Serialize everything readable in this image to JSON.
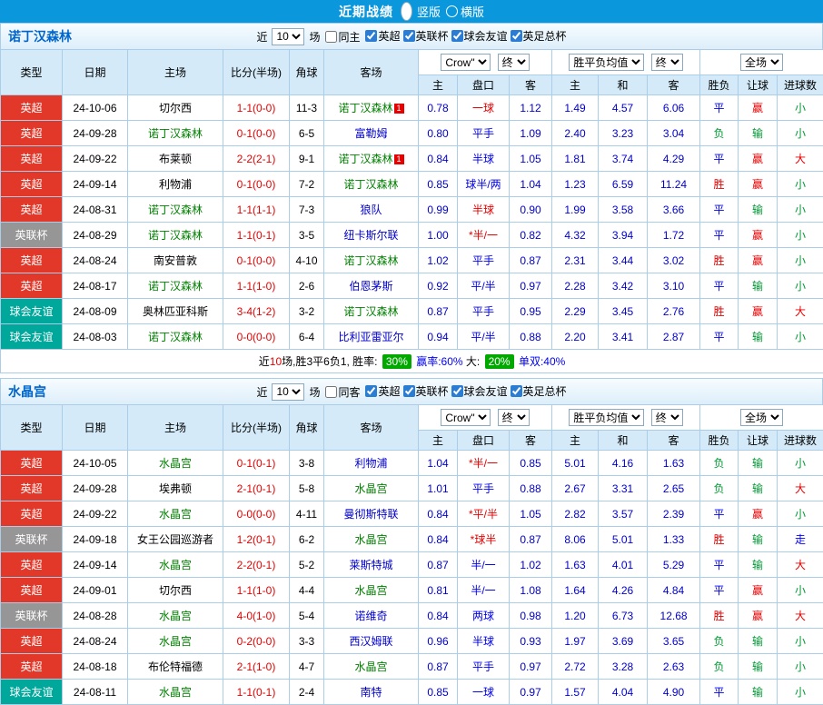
{
  "top_bar": {
    "title": "近期战绩",
    "layout_options": [
      {
        "label": "竖版",
        "selected": true
      },
      {
        "label": "横版",
        "selected": false
      }
    ]
  },
  "table_header": {
    "col_type": "类型",
    "col_date": "日期",
    "col_home": "主场",
    "col_score": "比分(半场)",
    "col_corner": "角球",
    "col_away": "客场",
    "sub_asian_home": "主",
    "sub_handicap": "盘口",
    "sub_asian_away": "客",
    "sub_euro_home": "主",
    "sub_euro_draw": "和",
    "sub_euro_away": "客",
    "sub_result": "胜负",
    "sub_let": "让球",
    "sub_goals": "进球数"
  },
  "colors": {
    "topbar_blue": "#0a97dc",
    "epl_red": "#e1382a",
    "league_cup_gray": "#969696",
    "friendly_teal": "#00a79b",
    "self_team_green": "#008000",
    "away_team_blue": "#0000cc",
    "score_red": "#e60000",
    "odds_blue": "#0000cc",
    "win_red": "#e60000",
    "lose_green": "#009933",
    "draw_blue": "#0000ee",
    "rate_box_green": "#00a800"
  },
  "sections": [
    {
      "team": "诺丁汉森林",
      "filter": {
        "near": "近",
        "count": "10",
        "games": "场",
        "same_label": "同主",
        "same_checked": false,
        "leagues": [
          {
            "label": "英超",
            "checked": true
          },
          {
            "label": "英联杯",
            "checked": true
          },
          {
            "label": "球会友谊",
            "checked": true
          },
          {
            "label": "英足总杯",
            "checked": true
          }
        ]
      },
      "dropdowns": {
        "company": "Crow\"",
        "company_time": "终",
        "euro": "胜平负均值",
        "euro_time": "终",
        "scope": "全场"
      },
      "rows": [
        {
          "type": "英超",
          "tcls": "t-epl",
          "date": "24-10-06",
          "home": "切尔西",
          "hcls": "c-home",
          "score": "1-1(0-0)",
          "corner": "11-3",
          "away": "诺丁汉森林",
          "acls": "c-self",
          "abadge": "1",
          "ah": [
            "0.78",
            "一球",
            "1.12"
          ],
          "lcls": "c-red",
          "eu": [
            "1.49",
            "4.57",
            "6.06"
          ],
          "wdl": "平",
          "wcls": "c-blue",
          "let": "赢",
          "letcls": "c-red",
          "size": "小",
          "scls": "c-green"
        },
        {
          "type": "英超",
          "tcls": "t-epl",
          "date": "24-09-28",
          "home": "诺丁汉森林",
          "hcls": "c-self",
          "score": "0-1(0-0)",
          "corner": "6-5",
          "away": "富勒姆",
          "acls": "c-away",
          "ah": [
            "0.80",
            "平手",
            "1.09"
          ],
          "lcls": "c-blue",
          "eu": [
            "2.40",
            "3.23",
            "3.04"
          ],
          "wdl": "负",
          "wcls": "c-green",
          "let": "输",
          "letcls": "c-green",
          "size": "小",
          "scls": "c-green"
        },
        {
          "type": "英超",
          "tcls": "t-epl",
          "date": "24-09-22",
          "home": "布莱顿",
          "hcls": "c-home",
          "score": "2-2(2-1)",
          "corner": "9-1",
          "away": "诺丁汉森林",
          "acls": "c-self",
          "abadge": "1",
          "ah": [
            "0.84",
            "半球",
            "1.05"
          ],
          "lcls": "c-blue",
          "eu": [
            "1.81",
            "3.74",
            "4.29"
          ],
          "wdl": "平",
          "wcls": "c-blue",
          "let": "赢",
          "letcls": "c-red",
          "size": "大",
          "scls": "c-red"
        },
        {
          "type": "英超",
          "tcls": "t-epl",
          "date": "24-09-14",
          "home": "利物浦",
          "hcls": "c-home",
          "score": "0-1(0-0)",
          "corner": "7-2",
          "away": "诺丁汉森林",
          "acls": "c-self",
          "ah": [
            "0.85",
            "球半/两",
            "1.04"
          ],
          "lcls": "c-blue",
          "eu": [
            "1.23",
            "6.59",
            "11.24"
          ],
          "wdl": "胜",
          "wcls": "c-red",
          "let": "赢",
          "letcls": "c-red",
          "size": "小",
          "scls": "c-green"
        },
        {
          "type": "英超",
          "tcls": "t-epl",
          "date": "24-08-31",
          "home": "诺丁汉森林",
          "hcls": "c-self",
          "score": "1-1(1-1)",
          "corner": "7-3",
          "away": "狼队",
          "acls": "c-away",
          "ah": [
            "0.99",
            "半球",
            "0.90"
          ],
          "lcls": "c-red",
          "eu": [
            "1.99",
            "3.58",
            "3.66"
          ],
          "wdl": "平",
          "wcls": "c-blue",
          "let": "输",
          "letcls": "c-green",
          "size": "小",
          "scls": "c-green"
        },
        {
          "type": "英联杯",
          "tcls": "t-lcup",
          "date": "24-08-29",
          "home": "诺丁汉森林",
          "hcls": "c-self",
          "score": "1-1(0-1)",
          "corner": "3-5",
          "away": "纽卡斯尔联",
          "acls": "c-away",
          "ah": [
            "1.00",
            "*半/一",
            "0.82"
          ],
          "lcls": "c-red",
          "eu": [
            "4.32",
            "3.94",
            "1.72"
          ],
          "wdl": "平",
          "wcls": "c-blue",
          "let": "赢",
          "letcls": "c-red",
          "size": "小",
          "scls": "c-green"
        },
        {
          "type": "英超",
          "tcls": "t-epl",
          "date": "24-08-24",
          "home": "南安普敦",
          "hcls": "c-home",
          "score": "0-1(0-0)",
          "corner": "4-10",
          "away": "诺丁汉森林",
          "acls": "c-self",
          "ah": [
            "1.02",
            "平手",
            "0.87"
          ],
          "lcls": "c-blue",
          "eu": [
            "2.31",
            "3.44",
            "3.02"
          ],
          "wdl": "胜",
          "wcls": "c-red",
          "let": "赢",
          "letcls": "c-red",
          "size": "小",
          "scls": "c-green"
        },
        {
          "type": "英超",
          "tcls": "t-epl",
          "date": "24-08-17",
          "home": "诺丁汉森林",
          "hcls": "c-self",
          "score": "1-1(1-0)",
          "corner": "2-6",
          "away": "伯恩茅斯",
          "acls": "c-away",
          "ah": [
            "0.92",
            "平/半",
            "0.97"
          ],
          "lcls": "c-blue",
          "eu": [
            "2.28",
            "3.42",
            "3.10"
          ],
          "wdl": "平",
          "wcls": "c-blue",
          "let": "输",
          "letcls": "c-green",
          "size": "小",
          "scls": "c-green"
        },
        {
          "type": "球会友谊",
          "tcls": "t-friendly",
          "date": "24-08-09",
          "home": "奥林匹亚科斯",
          "hcls": "c-home",
          "score": "3-4(1-2)",
          "corner": "3-2",
          "away": "诺丁汉森林",
          "acls": "c-self",
          "ah": [
            "0.87",
            "平手",
            "0.95"
          ],
          "lcls": "c-blue",
          "eu": [
            "2.29",
            "3.45",
            "2.76"
          ],
          "wdl": "胜",
          "wcls": "c-red",
          "let": "赢",
          "letcls": "c-red",
          "size": "大",
          "scls": "c-red"
        },
        {
          "type": "球会友谊",
          "tcls": "t-friendly",
          "date": "24-08-03",
          "home": "诺丁汉森林",
          "hcls": "c-self",
          "score": "0-0(0-0)",
          "corner": "6-4",
          "away": "比利亚雷亚尔",
          "acls": "c-away",
          "ah": [
            "0.94",
            "平/半",
            "0.88"
          ],
          "lcls": "c-blue",
          "eu": [
            "2.20",
            "3.41",
            "2.87"
          ],
          "wdl": "平",
          "wcls": "c-blue",
          "let": "输",
          "letcls": "c-green",
          "size": "小",
          "scls": "c-green"
        }
      ],
      "summary_parts": [
        {
          "t": "近",
          "c": "s-k"
        },
        {
          "t": "10",
          "c": "s-red"
        },
        {
          "t": "场,胜3平6负1, 胜率: ",
          "c": "s-k"
        },
        {
          "t": "30%",
          "c": "s-box"
        },
        {
          "t": " 赢率:60% ",
          "c": "s-blue"
        },
        {
          "t": "大: ",
          "c": "s-k"
        },
        {
          "t": "20%",
          "c": "s-box"
        },
        {
          "t": " 单双:40%",
          "c": "s-blue"
        }
      ]
    },
    {
      "team": "水晶宫",
      "filter": {
        "near": "近",
        "count": "10",
        "games": "场",
        "same_label": "同客",
        "same_checked": false,
        "leagues": [
          {
            "label": "英超",
            "checked": true
          },
          {
            "label": "英联杯",
            "checked": true
          },
          {
            "label": "球会友谊",
            "checked": true
          },
          {
            "label": "英足总杯",
            "checked": true
          }
        ]
      },
      "dropdowns": {
        "company": "Crow\"",
        "company_time": "终",
        "euro": "胜平负均值",
        "euro_time": "终",
        "scope": "全场"
      },
      "rows": [
        {
          "type": "英超",
          "tcls": "t-epl",
          "date": "24-10-05",
          "home": "水晶宫",
          "hcls": "c-self",
          "score": "0-1(0-1)",
          "corner": "3-8",
          "away": "利物浦",
          "acls": "c-away",
          "ah": [
            "1.04",
            "*半/一",
            "0.85"
          ],
          "lcls": "c-red",
          "eu": [
            "5.01",
            "4.16",
            "1.63"
          ],
          "wdl": "负",
          "wcls": "c-green",
          "let": "输",
          "letcls": "c-green",
          "size": "小",
          "scls": "c-green"
        },
        {
          "type": "英超",
          "tcls": "t-epl",
          "date": "24-09-28",
          "home": "埃弗顿",
          "hcls": "c-home",
          "score": "2-1(0-1)",
          "corner": "5-8",
          "away": "水晶宫",
          "acls": "c-self",
          "ah": [
            "1.01",
            "平手",
            "0.88"
          ],
          "lcls": "c-blue",
          "eu": [
            "2.67",
            "3.31",
            "2.65"
          ],
          "wdl": "负",
          "wcls": "c-green",
          "let": "输",
          "letcls": "c-green",
          "size": "大",
          "scls": "c-red"
        },
        {
          "type": "英超",
          "tcls": "t-epl",
          "date": "24-09-22",
          "home": "水晶宫",
          "hcls": "c-self",
          "score": "0-0(0-0)",
          "corner": "4-11",
          "away": "曼彻斯特联",
          "acls": "c-away",
          "ah": [
            "0.84",
            "*平/半",
            "1.05"
          ],
          "lcls": "c-red",
          "eu": [
            "2.82",
            "3.57",
            "2.39"
          ],
          "wdl": "平",
          "wcls": "c-blue",
          "let": "赢",
          "letcls": "c-red",
          "size": "小",
          "scls": "c-green"
        },
        {
          "type": "英联杯",
          "tcls": "t-lcup",
          "date": "24-09-18",
          "home": "女王公园巡游者",
          "hcls": "c-home",
          "score": "1-2(0-1)",
          "corner": "6-2",
          "away": "水晶宫",
          "acls": "c-self",
          "ah": [
            "0.84",
            "*球半",
            "0.87"
          ],
          "lcls": "c-red",
          "eu": [
            "8.06",
            "5.01",
            "1.33"
          ],
          "wdl": "胜",
          "wcls": "c-red",
          "let": "输",
          "letcls": "c-green",
          "size": "走",
          "scls": "c-blue"
        },
        {
          "type": "英超",
          "tcls": "t-epl",
          "date": "24-09-14",
          "home": "水晶宫",
          "hcls": "c-self",
          "score": "2-2(0-1)",
          "corner": "5-2",
          "away": "莱斯特城",
          "acls": "c-away",
          "ah": [
            "0.87",
            "半/一",
            "1.02"
          ],
          "lcls": "c-blue",
          "eu": [
            "1.63",
            "4.01",
            "5.29"
          ],
          "wdl": "平",
          "wcls": "c-blue",
          "let": "输",
          "letcls": "c-green",
          "size": "大",
          "scls": "c-red"
        },
        {
          "type": "英超",
          "tcls": "t-epl",
          "date": "24-09-01",
          "home": "切尔西",
          "hcls": "c-home",
          "score": "1-1(1-0)",
          "corner": "4-4",
          "away": "水晶宫",
          "acls": "c-self",
          "ah": [
            "0.81",
            "半/一",
            "1.08"
          ],
          "lcls": "c-blue",
          "eu": [
            "1.64",
            "4.26",
            "4.84"
          ],
          "wdl": "平",
          "wcls": "c-blue",
          "let": "赢",
          "letcls": "c-red",
          "size": "小",
          "scls": "c-green"
        },
        {
          "type": "英联杯",
          "tcls": "t-lcup",
          "date": "24-08-28",
          "home": "水晶宫",
          "hcls": "c-self",
          "score": "4-0(1-0)",
          "corner": "5-4",
          "away": "诺维奇",
          "acls": "c-away",
          "ah": [
            "0.84",
            "两球",
            "0.98"
          ],
          "lcls": "c-blue",
          "eu": [
            "1.20",
            "6.73",
            "12.68"
          ],
          "wdl": "胜",
          "wcls": "c-red",
          "let": "赢",
          "letcls": "c-red",
          "size": "大",
          "scls": "c-red"
        },
        {
          "type": "英超",
          "tcls": "t-epl",
          "date": "24-08-24",
          "home": "水晶宫",
          "hcls": "c-self",
          "score": "0-2(0-0)",
          "corner": "3-3",
          "away": "西汉姆联",
          "acls": "c-away",
          "ah": [
            "0.96",
            "半球",
            "0.93"
          ],
          "lcls": "c-blue",
          "eu": [
            "1.97",
            "3.69",
            "3.65"
          ],
          "wdl": "负",
          "wcls": "c-green",
          "let": "输",
          "letcls": "c-green",
          "size": "小",
          "scls": "c-green"
        },
        {
          "type": "英超",
          "tcls": "t-epl",
          "date": "24-08-18",
          "home": "布伦特福德",
          "hcls": "c-home",
          "score": "2-1(1-0)",
          "corner": "4-7",
          "away": "水晶宫",
          "acls": "c-self",
          "ah": [
            "0.87",
            "平手",
            "0.97"
          ],
          "lcls": "c-blue",
          "eu": [
            "2.72",
            "3.28",
            "2.63"
          ],
          "wdl": "负",
          "wcls": "c-green",
          "let": "输",
          "letcls": "c-green",
          "size": "小",
          "scls": "c-green"
        },
        {
          "type": "球会友谊",
          "tcls": "t-friendly",
          "date": "24-08-11",
          "home": "水晶宫",
          "hcls": "c-self",
          "score": "1-1(0-1)",
          "corner": "2-4",
          "away": "南特",
          "acls": "c-away",
          "ah": [
            "0.85",
            "一球",
            "0.97"
          ],
          "lcls": "c-blue",
          "eu": [
            "1.57",
            "4.04",
            "4.90"
          ],
          "wdl": "平",
          "wcls": "c-blue",
          "let": "输",
          "letcls": "c-green",
          "size": "小",
          "scls": "c-green"
        }
      ],
      "summary_parts": []
    }
  ]
}
